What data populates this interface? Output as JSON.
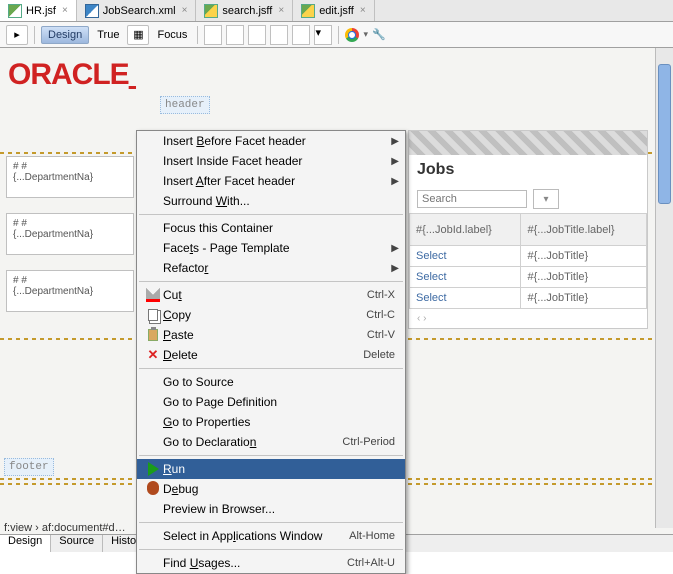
{
  "tabs": [
    {
      "label": "HR.jsf",
      "icon": "jsf",
      "active": true
    },
    {
      "label": "JobSearch.xml",
      "icon": "xml",
      "active": false
    },
    {
      "label": "search.jsff",
      "icon": "jsff",
      "active": false
    },
    {
      "label": "edit.jsff",
      "icon": "jsff",
      "active": false
    }
  ],
  "toolbar": {
    "design": "Design",
    "true": "True",
    "focus": "Focus"
  },
  "logo": "ORACLE",
  "header_placeholder": "header",
  "footer_placeholder": "footer",
  "cards": [
    {
      "l1": "#    #",
      "l2": "{...DepartmentNa}"
    },
    {
      "l1": "#    #",
      "l2": "{...DepartmentNa}"
    },
    {
      "l1": "#    #",
      "l2": "{...DepartmentNa}"
    }
  ],
  "right": {
    "jobs": "Jobs",
    "search_placeholder": "Search",
    "th1": "#{...JobId.label}",
    "th2": "#{...JobTitle.label}",
    "rows": [
      [
        "Select",
        "#{...JobTitle}"
      ],
      [
        "Select",
        "#{...JobTitle}"
      ],
      [
        "Select",
        "#{...JobTitle}"
      ]
    ],
    "pager": "‹  ›"
  },
  "breadcrumb": "f:view  ›  af:document#d…",
  "bottom": [
    "Design",
    "Source",
    "History"
  ],
  "ctx": [
    {
      "t": "item",
      "label": "Insert <u>B</u>efore Facet   header",
      "sub": true
    },
    {
      "t": "item",
      "label": "Insert Inside Facet   header",
      "sub": true
    },
    {
      "t": "item",
      "label": "Insert <u>A</u>fter Facet   header",
      "sub": true
    },
    {
      "t": "item",
      "label": "Surround <u>W</u>ith..."
    },
    {
      "t": "sep"
    },
    {
      "t": "item",
      "label": "Focus this Container"
    },
    {
      "t": "item",
      "label": "Face<u>t</u>s - Page Template",
      "sub": true
    },
    {
      "t": "item",
      "label": "Refacto<u>r</u>",
      "sub": true
    },
    {
      "t": "sep"
    },
    {
      "t": "item",
      "label": "Cu<u>t</u>",
      "icon": "cut",
      "shortcut": "Ctrl-X"
    },
    {
      "t": "item",
      "label": "<u>C</u>opy",
      "icon": "copy",
      "shortcut": "Ctrl-C"
    },
    {
      "t": "item",
      "label": "<u>P</u>aste",
      "icon": "paste",
      "shortcut": "Ctrl-V"
    },
    {
      "t": "item",
      "label": "<u>D</u>elete",
      "icon": "del",
      "shortcut": "Delete"
    },
    {
      "t": "sep"
    },
    {
      "t": "item",
      "label": "Go to Source"
    },
    {
      "t": "item",
      "label": "Go to Pa<u>g</u>e Definition"
    },
    {
      "t": "item",
      "label": "<u>G</u>o to Properties"
    },
    {
      "t": "item",
      "label": "Go to Declaratio<u>n</u>",
      "shortcut": "Ctrl-Period"
    },
    {
      "t": "sep"
    },
    {
      "t": "item",
      "label": "<u>R</u>un",
      "icon": "run",
      "selected": true
    },
    {
      "t": "item",
      "label": "D<u>e</u>bug",
      "icon": "bug"
    },
    {
      "t": "item",
      "label": "Preview in Browser..."
    },
    {
      "t": "sep"
    },
    {
      "t": "item",
      "label": "Select in App<u>l</u>ications Window",
      "shortcut": "Alt-Home"
    },
    {
      "t": "sep"
    },
    {
      "t": "item",
      "label": "Find <u>U</u>sages...",
      "shortcut": "Ctrl+Alt-U"
    }
  ]
}
